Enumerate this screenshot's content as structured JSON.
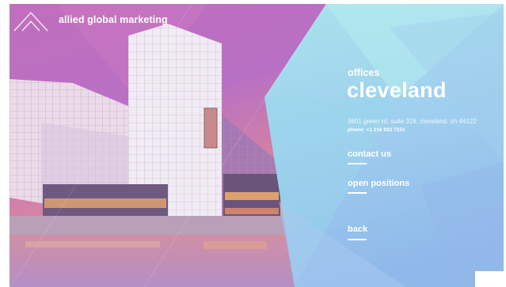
{
  "header": {
    "brand": "allied global marketing",
    "logo_icon": "diamond-logo-icon"
  },
  "office": {
    "heading": "offices",
    "city": "cleveland",
    "address": "3601 green rd, suite 316, cleveland, oh 44122",
    "phone": "phone: +1 216 932 7151"
  },
  "nav": {
    "contact_label": "contact us",
    "positions_label": "open positions",
    "back_label": "back"
  },
  "colors": {
    "left_gradient_top": "#c36fbe",
    "left_gradient_bottom": "#e89a8e",
    "right_gradient_top": "#a6e4ee",
    "right_gradient_bottom": "#8cb8ea",
    "text": "#ffffff"
  }
}
